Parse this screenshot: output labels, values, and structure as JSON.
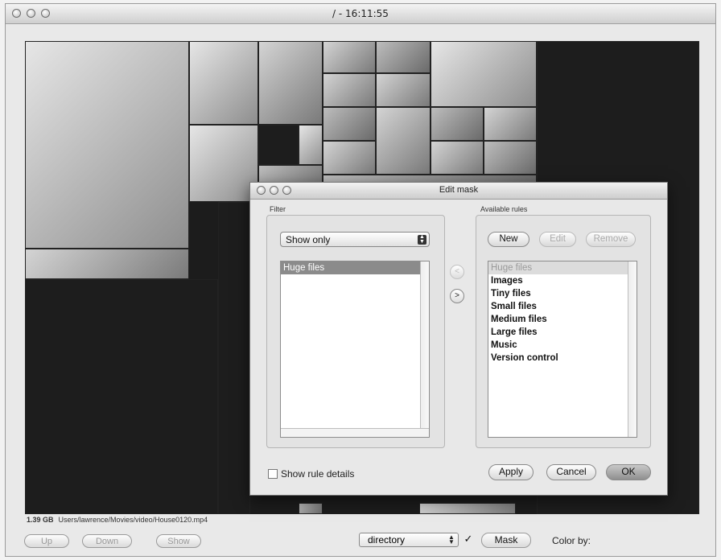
{
  "window": {
    "title": "/ - 16:11:55"
  },
  "statusbar": {
    "size": "1.39 GB",
    "path": "Users/lawrence/Movies/video/House0120.mp4"
  },
  "bottom_controls": {
    "up_label": "Up",
    "down_label": "Down",
    "show_label": "Show",
    "group_by_value": "directory",
    "mask_enabled_mark": "✓",
    "mask_label": "Mask",
    "color_by_label": "Color by:"
  },
  "dialog": {
    "title": "Edit mask",
    "filter_label": "Filter",
    "filter_mode": "Show only",
    "filter_items": [
      "Huge files"
    ],
    "move_left_glyph": "<",
    "move_right_glyph": ">",
    "available_label": "Available rules",
    "new_label": "New",
    "edit_label": "Edit",
    "remove_label": "Remove",
    "available_rules": [
      "Huge files",
      "Images",
      "Tiny files",
      "Small files",
      "Medium files",
      "Large files",
      "Music",
      "Version control"
    ],
    "show_rule_details_label": "Show rule details",
    "apply_label": "Apply",
    "cancel_label": "Cancel",
    "ok_label": "OK"
  }
}
